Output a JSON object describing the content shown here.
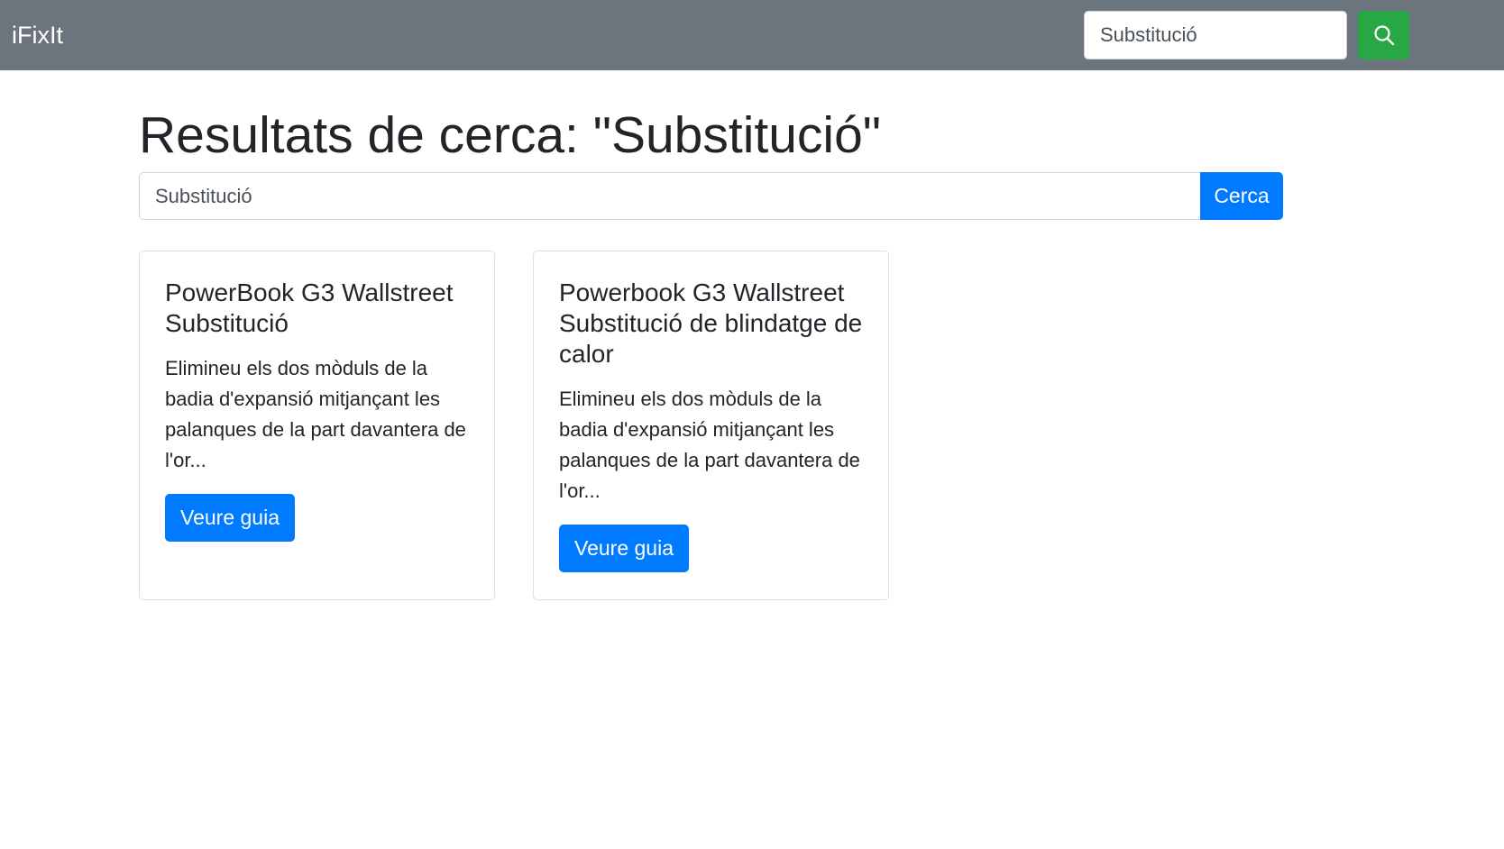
{
  "navbar": {
    "brand": "iFixIt",
    "search_value": "Substitució",
    "search_icon": "search-icon",
    "background_color": "#6c757d",
    "search_button_color": "#28a745"
  },
  "main": {
    "title": "Resultats de cerca: \"Substitució\"",
    "search_value": "Substitució",
    "search_button_label": "Cerca",
    "accent_color": "#007bff"
  },
  "results": [
    {
      "title": "PowerBook G3 Wallstreet Substitució",
      "description": "Elimineu els dos mòduls de la badia d'expansió mitjançant les palanques de la part davantera de l'or...",
      "button_label": "Veure guia"
    },
    {
      "title": "Powerbook G3 Wallstreet Substitució de blindatge de calor",
      "description": "Elimineu els dos mòduls de la badia d'expansió mitjançant les palanques de la part davantera de l'or...",
      "button_label": "Veure guia"
    }
  ]
}
